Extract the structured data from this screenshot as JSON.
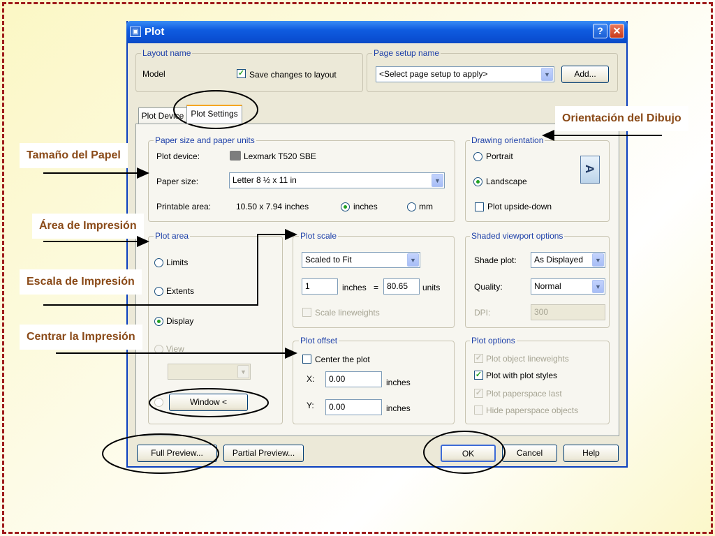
{
  "dialog": {
    "title": "Plot",
    "help_icon": "question-mark-icon",
    "close_icon": "close-x-icon"
  },
  "layout_name": {
    "group_title": "Layout name",
    "value": "Model",
    "save_changes_label": "Save changes to layout",
    "save_changes_checked": true
  },
  "page_setup": {
    "group_title": "Page setup name",
    "selected": "<Select page setup to apply>",
    "add_button": "Add..."
  },
  "tabs": [
    {
      "label": "Plot Device",
      "active": false
    },
    {
      "label": "Plot Settings",
      "active": true
    }
  ],
  "paper": {
    "group_title": "Paper size and paper units",
    "plot_device_label": "Plot device:",
    "plot_device_value": "Lexmark T520 SBE",
    "paper_size_label": "Paper size:",
    "paper_size_value": "Letter 8 ½ x 11 in",
    "printable_area_label": "Printable area:",
    "printable_area_value": "10.50 x 7.94 inches",
    "unit_inches": "inches",
    "unit_mm": "mm",
    "selected_unit": "inches"
  },
  "orientation": {
    "group_title": "Drawing orientation",
    "portrait": "Portrait",
    "landscape": "Landscape",
    "upside_down": "Plot upside-down",
    "selected": "landscape",
    "preview_letter": "A"
  },
  "plot_area": {
    "group_title": "Plot area",
    "limits": "Limits",
    "extents": "Extents",
    "display": "Display",
    "view": "View",
    "selected": "display",
    "window_button": "Window <"
  },
  "plot_scale": {
    "group_title": "Plot scale",
    "scale_value": "Scaled to Fit",
    "inches_value": "1",
    "inches_label": "inches",
    "equals": "=",
    "units_value": "80.65",
    "units_label": "units",
    "scale_lineweights": "Scale lineweights"
  },
  "plot_offset": {
    "group_title": "Plot offset",
    "center_label": "Center the plot",
    "x_label": "X:",
    "x_value": "0.00",
    "y_label": "Y:",
    "y_value": "0.00",
    "unit": "inches"
  },
  "shaded": {
    "group_title": "Shaded viewport options",
    "shade_plot_label": "Shade plot:",
    "shade_plot_value": "As Displayed",
    "quality_label": "Quality:",
    "quality_value": "Normal",
    "dpi_label": "DPI:",
    "dpi_value": "300"
  },
  "plot_options": {
    "group_title": "Plot options",
    "items": [
      {
        "label": "Plot object lineweights",
        "checked": true,
        "enabled": false
      },
      {
        "label": "Plot with plot styles",
        "checked": true,
        "enabled": true
      },
      {
        "label": "Plot paperspace last",
        "checked": true,
        "enabled": false
      },
      {
        "label": "Hide paperspace objects",
        "checked": false,
        "enabled": false
      }
    ]
  },
  "buttons": {
    "full_preview": "Full Preview...",
    "partial_preview": "Partial Preview...",
    "ok": "OK",
    "cancel": "Cancel",
    "help": "Help"
  },
  "annotations": {
    "paper_size": "Tamaño del Papel",
    "print_area": "Área de Impresión",
    "print_scale": "Escala de Impresión",
    "center_print": "Centrar la Impresión",
    "orientation": "Orientación del Dibujo"
  },
  "colors": {
    "frame_border": "#9e1b1b",
    "titlebar": "#0a4fd3",
    "group_title": "#1c3fa8",
    "annotation_text": "#8a4a18",
    "radio_check_mark": "#21a121"
  }
}
